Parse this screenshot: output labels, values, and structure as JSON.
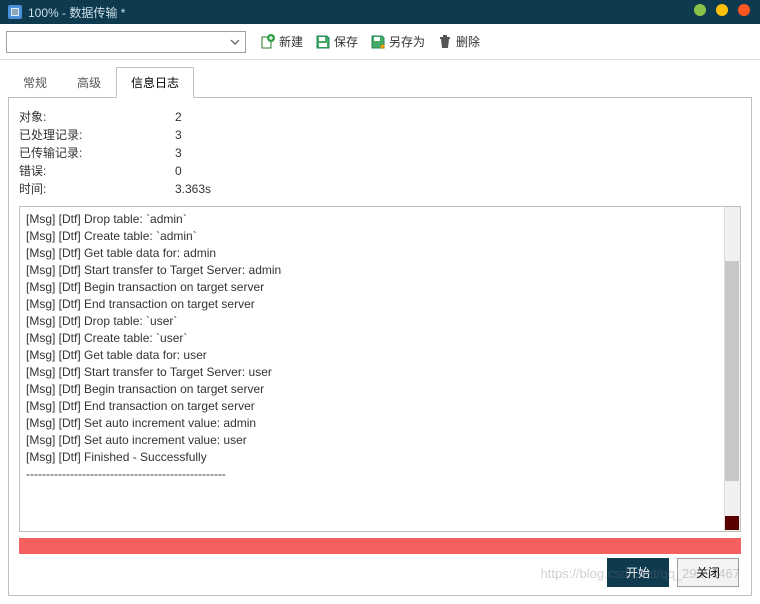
{
  "titlebar": {
    "title": "100% - 数据传输 *"
  },
  "toolbar": {
    "new_label": "新建",
    "save_label": "保存",
    "saveas_label": "另存为",
    "delete_label": "删除"
  },
  "tabs": {
    "general": "常规",
    "advanced": "高级",
    "log": "信息日志"
  },
  "stats": {
    "objects_label": "对象:",
    "objects_value": "2",
    "processed_label": "已处理记录:",
    "processed_value": "3",
    "transferred_label": "已传输记录:",
    "transferred_value": "3",
    "errors_label": "错误:",
    "errors_value": "0",
    "time_label": "时间:",
    "time_value": "3.363s"
  },
  "log_lines": [
    "[Msg] [Dtf] Drop table: `admin`",
    "[Msg] [Dtf] Create table: `admin`",
    "[Msg] [Dtf] Get table data for: admin",
    "[Msg] [Dtf] Start transfer to Target Server: admin",
    "[Msg] [Dtf] Begin transaction on target server",
    "[Msg] [Dtf] End transaction on target server",
    "[Msg] [Dtf] Drop table: `user`",
    "[Msg] [Dtf] Create table: `user`",
    "[Msg] [Dtf] Get table data for: user",
    "[Msg] [Dtf] Start transfer to Target Server: user",
    "[Msg] [Dtf] Begin transaction on target server",
    "[Msg] [Dtf] End transaction on target server",
    "[Msg] [Dtf] Set auto increment value: admin",
    "[Msg] [Dtf] Set auto increment value: user",
    "[Msg] [Dtf] Finished - Successfully",
    "--------------------------------------------------"
  ],
  "footer": {
    "start": "开始",
    "close": "关闭"
  },
  "watermark": "https://blog.csdn.net/qq_29399467"
}
